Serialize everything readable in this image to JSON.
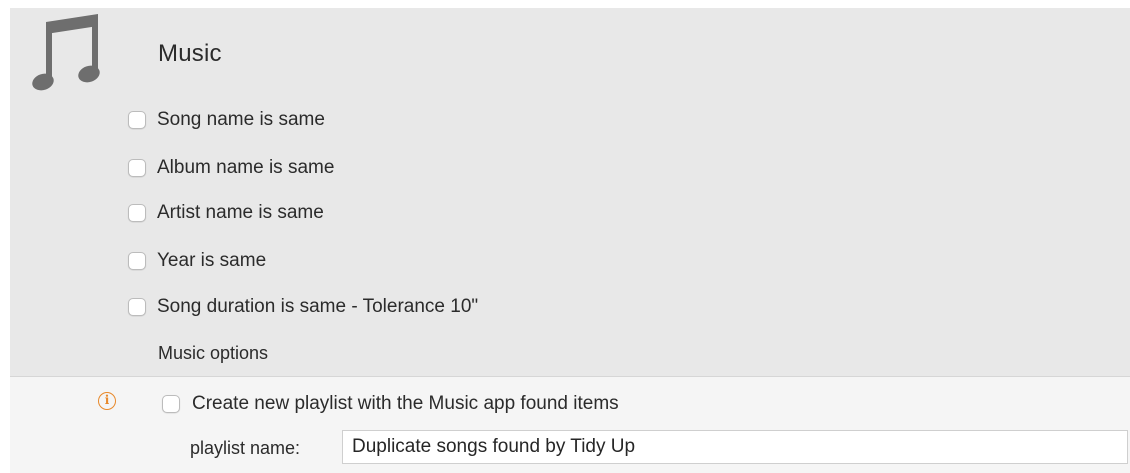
{
  "section": {
    "title": "Music",
    "icon": "music-note-icon",
    "icon_color": "#6e6e6e"
  },
  "options": [
    {
      "label": "Song name is same",
      "checked": false
    },
    {
      "label": "Album name is same",
      "checked": false
    },
    {
      "label": "Artist name is same",
      "checked": false
    },
    {
      "label": "Year is same",
      "checked": false
    },
    {
      "label": "Song duration is same - Tolerance 10\"",
      "checked": false
    }
  ],
  "music_options": {
    "heading": "Music options",
    "info_icon": "info-icon",
    "info_color": "#e8892b",
    "playlist_checkbox": {
      "label": "Create new playlist with the Music app found items",
      "checked": false
    },
    "playlist_name_label": "playlist name:",
    "playlist_name_value": "Duplicate songs found by Tidy Up"
  }
}
